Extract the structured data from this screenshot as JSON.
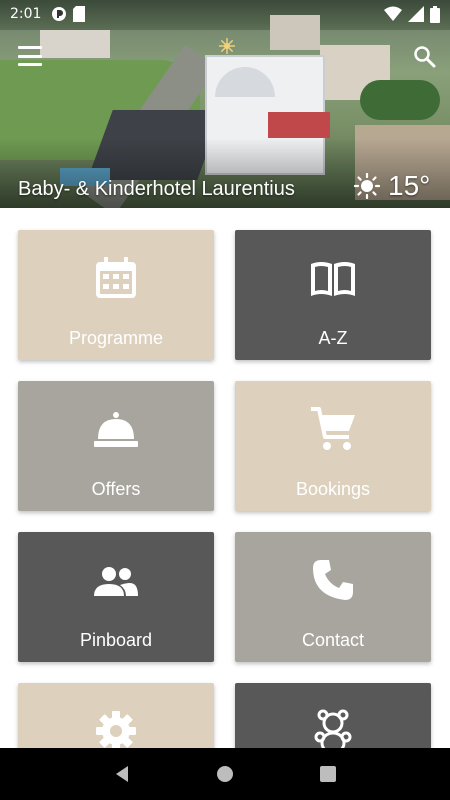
{
  "status_bar": {
    "time": "2:01",
    "left_icons": [
      "app-notification-icon",
      "sd-card-icon"
    ],
    "right_icons": [
      "wifi-icon",
      "cellular-signal-icon",
      "battery-icon"
    ]
  },
  "header": {
    "hotel_name": "Baby- & Kinderhotel Laurentius",
    "weather": {
      "icon": "sun-icon",
      "temperature": "15°"
    },
    "menu_icon": "hamburger-menu-icon",
    "search_icon": "search-icon",
    "logo_icon": "hotel-logo-icon"
  },
  "tiles": [
    {
      "label": "Programme",
      "icon": "calendar-icon",
      "color": "#ddd1bd"
    },
    {
      "label": "A-Z",
      "icon": "open-book-icon",
      "color": "#585858"
    },
    {
      "label": "Offers",
      "icon": "service-bell-icon",
      "color": "#a8a59e"
    },
    {
      "label": "Bookings",
      "icon": "shopping-cart-icon",
      "color": "#ddd1bd"
    },
    {
      "label": "Pinboard",
      "icon": "group-icon",
      "color": "#585858"
    },
    {
      "label": "Contact",
      "icon": "phone-icon",
      "color": "#a8a59e"
    },
    {
      "label": "",
      "icon": "gear-icon",
      "color": "#ddd1bd"
    },
    {
      "label": "",
      "icon": "teddy-bear-icon",
      "color": "#585858"
    }
  ],
  "nav_bar": {
    "back_icon": "back-triangle-icon",
    "home_icon": "home-circle-icon",
    "recents_icon": "recents-square-icon"
  }
}
